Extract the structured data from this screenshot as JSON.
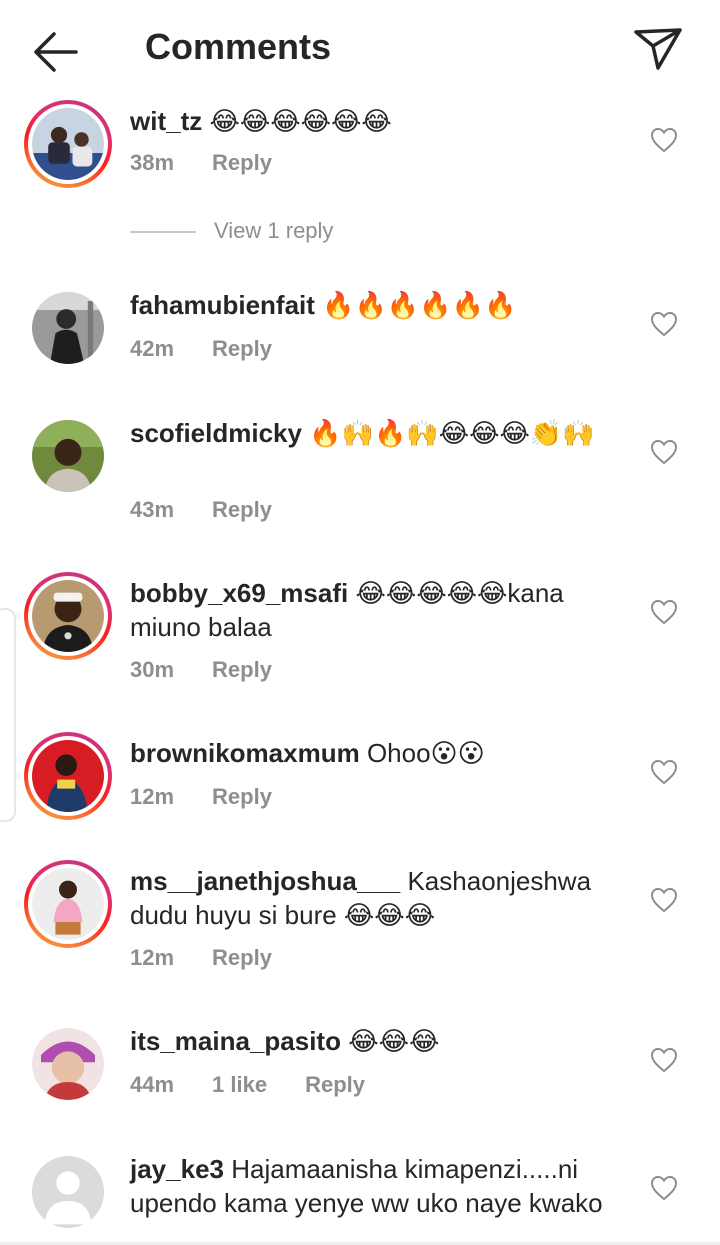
{
  "header": {
    "title": "Comments",
    "back_icon": "arrow-left-icon",
    "send_icon": "send-icon"
  },
  "colors": {
    "meta_gray": "#8e8e8e",
    "text": "#262626",
    "ring_start": "#c13584",
    "ring_end": "#fcaf45"
  },
  "comments": [
    {
      "username": "wit_tz",
      "text": "😂😂😂😂😂😂",
      "time": "38m",
      "likes": "",
      "reply_label": "Reply",
      "view_replies": "View 1 reply"
    },
    {
      "username": "fahamubienfait",
      "text": "🔥🔥🔥🔥🔥🔥",
      "time": "42m",
      "likes": "",
      "reply_label": "Reply"
    },
    {
      "username": "scofieldmicky",
      "text": "🔥🙌🔥🙌😂😂😂👏🙌",
      "time": "43m",
      "likes": "",
      "reply_label": "Reply"
    },
    {
      "username": "bobby_x69_msafi",
      "text": "😂😂😂😂😂kana miuno balaa",
      "time": "30m",
      "likes": "",
      "reply_label": "Reply"
    },
    {
      "username": "brownikomaxmum",
      "text": "Ohoo😮😮",
      "time": "12m",
      "likes": "",
      "reply_label": "Reply"
    },
    {
      "username": "ms__janethjoshua___",
      "text": "Kashaonjeshwa dudu huyu si bure 😂😂😂",
      "time": "12m",
      "likes": "",
      "reply_label": "Reply"
    },
    {
      "username": "its_maina_pasito",
      "text": "😂😂😂",
      "time": "44m",
      "likes": "1 like",
      "reply_label": "Reply"
    },
    {
      "username": "jay_ke3",
      "text": "Hajamaanisha kimapenzi.....ni upendo kama yenye ww uko naye kwako",
      "time": "",
      "likes": "",
      "reply_label": ""
    }
  ]
}
